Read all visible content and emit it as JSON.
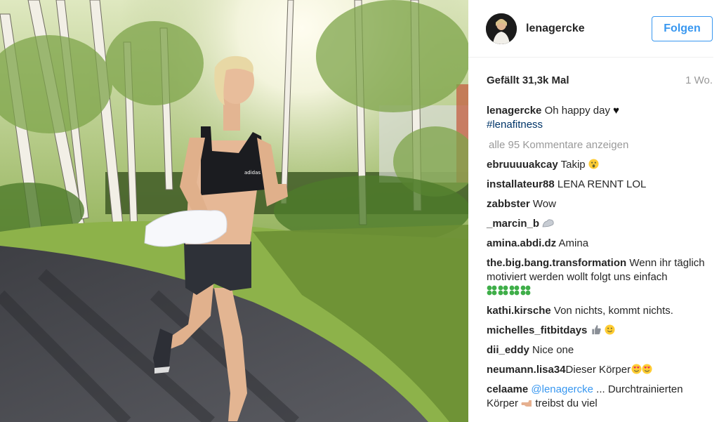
{
  "post": {
    "header": {
      "username": "lenagercke",
      "follow_label": "Folgen"
    },
    "likes": "Gefällt 31,3k Mal",
    "age": "1 Wo.",
    "caption": {
      "user": "lenagercke",
      "text": "Oh happy day",
      "hashtag": "#lenafitness"
    },
    "view_all_comments": "alle 95 Kommentare anzeigen",
    "comments": [
      {
        "user": "ebruuuuakcay",
        "text": "Takip"
      },
      {
        "user": "installateur88",
        "text": "LENA RENNT LOL"
      },
      {
        "user": "zabbster",
        "text": "Wow"
      },
      {
        "user": "_marcin_b",
        "text": ""
      },
      {
        "user": "amina.abdi.dz",
        "text": "Amina"
      },
      {
        "user": "the.big.bang.transformation",
        "text": "Wenn ihr täglich motiviert werden wollt folgt uns einfach"
      },
      {
        "user": "kathi.kirsche",
        "text": "Von nichts, kommt nichts."
      },
      {
        "user": "michelles_fitbitdays",
        "text": ""
      },
      {
        "user": "dii_eddy",
        "text": "Nice one"
      },
      {
        "user": "neumann.lisa34",
        "text": "Dieser Körper"
      },
      {
        "user": "celaame",
        "mention": "@lenagercke",
        "text": "... Durchtrainierten Körper",
        "text2": "treibst du viel"
      }
    ]
  },
  "colors": {
    "link_blue": "#3897f0",
    "hashtag": "#003569",
    "muted": "#999999"
  },
  "icons": [
    "heart-icon",
    "astonished-emoji-icon",
    "flexed-biceps-icon",
    "four-leaf-clover-icon",
    "thumbs-up-icon",
    "smiley-emoji-icon",
    "heart-eyes-emoji-icon",
    "pointing-hand-icon"
  ]
}
